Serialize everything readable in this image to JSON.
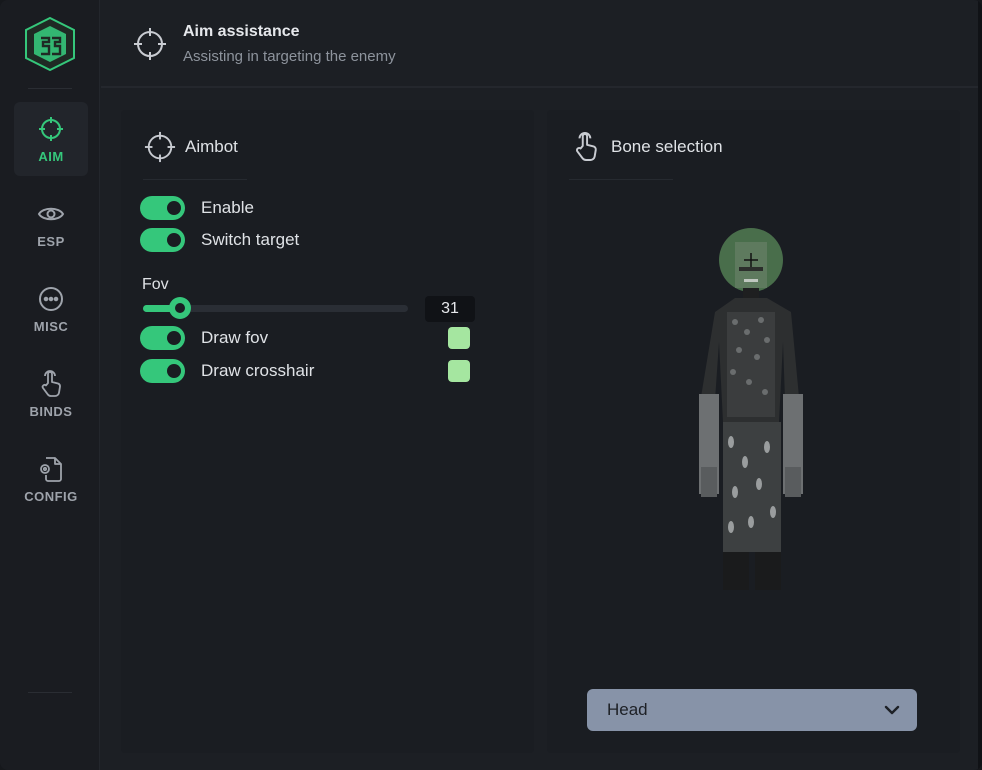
{
  "app": {
    "logo_text": "SSG",
    "accent_color": "#35c77b"
  },
  "sidebar": {
    "items": [
      {
        "label": "AIM",
        "icon": "crosshair-icon",
        "active": true
      },
      {
        "label": "ESP",
        "icon": "eye-icon",
        "active": false
      },
      {
        "label": "MISC",
        "icon": "dots-icon",
        "active": false
      },
      {
        "label": "BINDS",
        "icon": "pointer-hand-icon",
        "active": false
      },
      {
        "label": "CONFIG",
        "icon": "config-file-icon",
        "active": false
      }
    ]
  },
  "header": {
    "title": "Aim assistance",
    "subtitle": "Assisting in targeting the enemy",
    "icon": "crosshair-icon"
  },
  "aimbot": {
    "title": "Aimbot",
    "enable_label": "Enable",
    "enable_on": true,
    "switch_target_label": "Switch target",
    "switch_target_on": true,
    "fov_label": "Fov",
    "fov_value": "31",
    "fov_fraction": 0.14,
    "draw_fov_label": "Draw fov",
    "draw_fov_on": true,
    "draw_fov_color": "#a5e6a0",
    "draw_crosshair_label": "Draw crosshair",
    "draw_crosshair_on": true,
    "draw_crosshair_color": "#a5e6a0"
  },
  "bone_selection": {
    "title": "Bone selection",
    "selected": "Head"
  }
}
